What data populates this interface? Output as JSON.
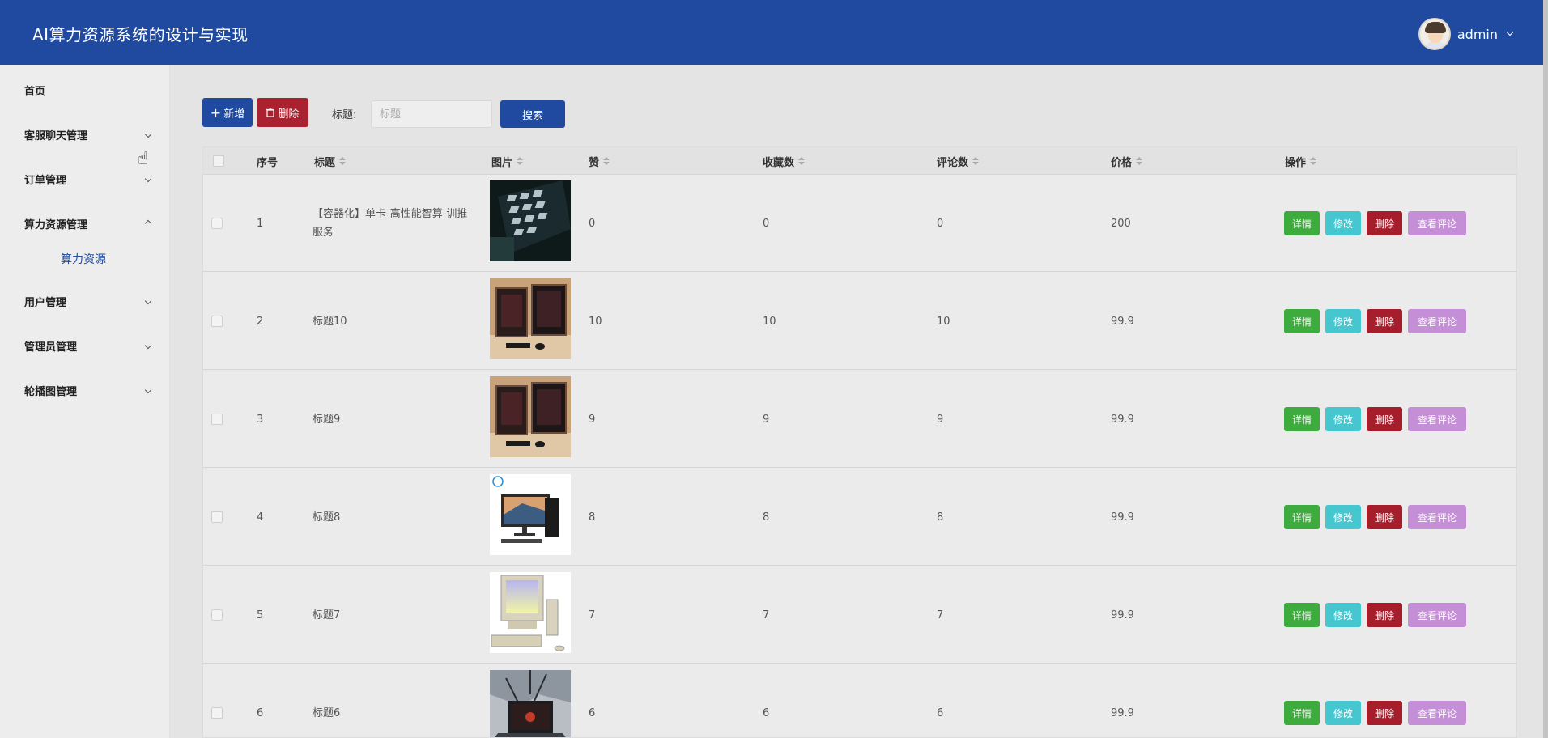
{
  "header": {
    "title": "AI算力资源系统的设计与实现",
    "username": "admin"
  },
  "sidebar": {
    "items": [
      {
        "label": "首页"
      },
      {
        "label": "客服聊天管理"
      },
      {
        "label": "订单管理"
      },
      {
        "label": "算力资源管理"
      },
      {
        "label": "算力资源"
      },
      {
        "label": "用户管理"
      },
      {
        "label": "管理员管理"
      },
      {
        "label": "轮播图管理"
      }
    ]
  },
  "toolbar": {
    "add_label": "新增",
    "add_icon": "+",
    "delete_label": "删除",
    "delete_icon": "trash-icon",
    "search_label": "标题:",
    "search_placeholder": "标题",
    "search_button": "搜索"
  },
  "table": {
    "headers": [
      "序号",
      "标题",
      "图片",
      "赞",
      "收藏数",
      "评论数",
      "价格",
      "操作"
    ],
    "rows": [
      {
        "index": "1",
        "title": "【容器化】单卡-高性能智算-训推服务",
        "image": "gpu-servers",
        "likes": "0",
        "favorites": "0",
        "comments": "0",
        "price": "200"
      },
      {
        "index": "2",
        "title": "标题10",
        "image": "desktop-pcs",
        "likes": "10",
        "favorites": "10",
        "comments": "10",
        "price": "99.9"
      },
      {
        "index": "3",
        "title": "标题9",
        "image": "desktop-pcs",
        "likes": "9",
        "favorites": "9",
        "comments": "9",
        "price": "99.9"
      },
      {
        "index": "4",
        "title": "标题8",
        "image": "dell-desktop",
        "likes": "8",
        "favorites": "8",
        "comments": "8",
        "price": "99.9"
      },
      {
        "index": "5",
        "title": "标题7",
        "image": "retro-pc",
        "likes": "7",
        "favorites": "7",
        "comments": "7",
        "price": "99.9"
      },
      {
        "index": "6",
        "title": "标题6",
        "image": "laptop-splash",
        "likes": "6",
        "favorites": "6",
        "comments": "6",
        "price": "99.9"
      }
    ],
    "actions": {
      "detail": "详情",
      "edit": "修改",
      "delete": "删除",
      "view_comments": "查看评论"
    }
  },
  "colors": {
    "header": "#1f4aa0",
    "delete": "#aa2230",
    "detail": "#3dab3d",
    "edit": "#46c7d0",
    "review": "#c48fd6"
  }
}
